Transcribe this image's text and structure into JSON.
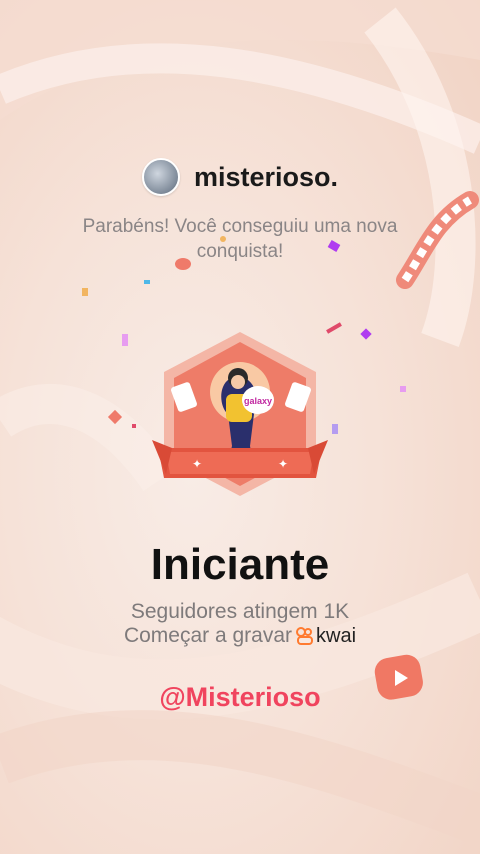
{
  "user": {
    "name": "misterioso."
  },
  "message": "Parabéns! Você conseguiu uma nova conquista!",
  "achievement": {
    "title": "Iniciante",
    "line1": "Seguidores atingem 1K",
    "line2": "Começar a gravar",
    "brand": "kwai",
    "badge_text": "galaxy"
  },
  "handle": "@Misterioso",
  "colors": {
    "accent": "#f0445e",
    "badge": "#e9624f",
    "brand": "#ff7a2f"
  },
  "icons": [
    "avatar-icon",
    "achievement-badge-icon",
    "kwai-logo-icon",
    "play-icon"
  ]
}
